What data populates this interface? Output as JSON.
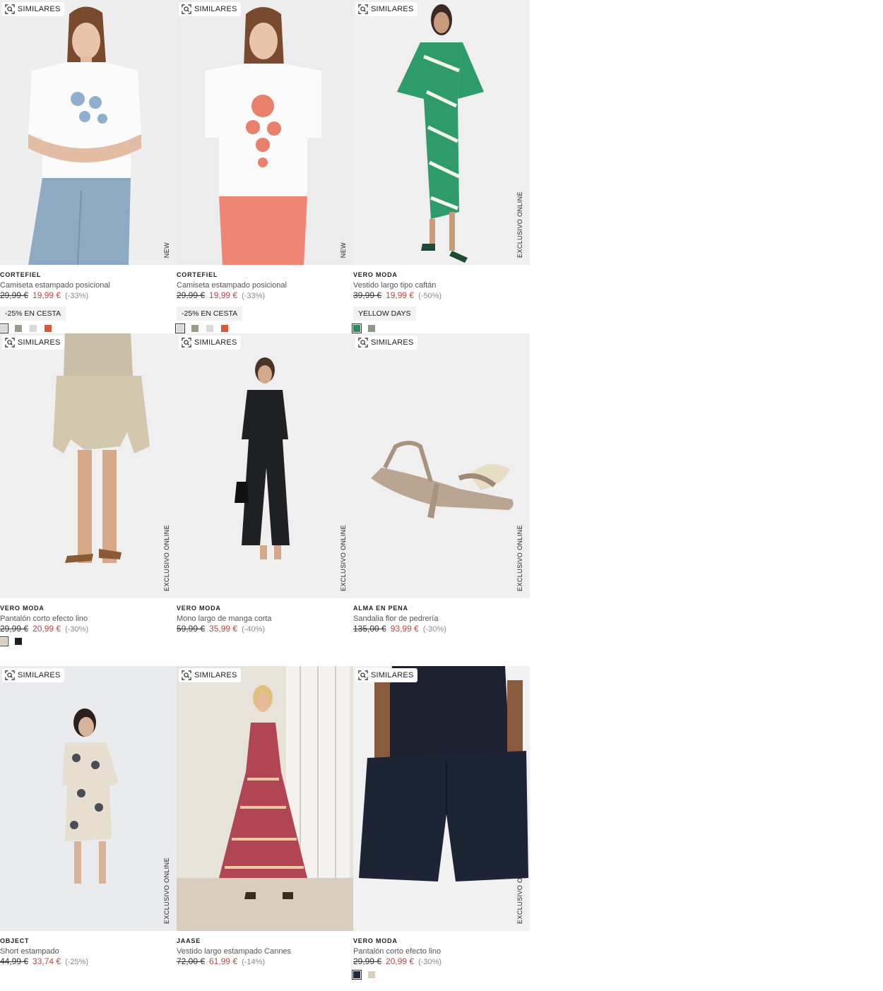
{
  "similar_label": "SIMILARES",
  "products": [
    {
      "brand": "CORTEFIEL",
      "name": "Camiseta estampado posicional",
      "old_price": "29,99 €",
      "new_price": "19,99 €",
      "discount": "(-33%)",
      "tag": "NEW",
      "promo": "-25% EN CESTA",
      "swatches": [
        "#d9d9d9",
        "#9c9a8c",
        "#d8d8de",
        "#d9593c"
      ]
    },
    {
      "brand": "CORTEFIEL",
      "name": "Camiseta estampado posicional",
      "old_price": "29,99 €",
      "new_price": "19,99 €",
      "discount": "(-33%)",
      "tag": "NEW",
      "promo": "-25% EN CESTA",
      "swatches": [
        "#d9d9d9",
        "#9c9a8c",
        "#d8d8de",
        "#d9593c"
      ]
    },
    {
      "brand": "VERO MODA",
      "name": "Vestido largo tipo caftán",
      "old_price": "39,99 €",
      "new_price": "19,99 €",
      "discount": "(-50%)",
      "tag": "EXCLUSIVO ONLINE",
      "promo": "YELLOW DAYS",
      "swatches": [
        "#2e8a5b",
        "#8b9a86"
      ]
    },
    {
      "brand": "VERO MODA",
      "name": "Pantalón corto efecto lino",
      "old_price": "29,99 €",
      "new_price": "20,99 €",
      "discount": "(-30%)",
      "tag": "EXCLUSIVO ONLINE",
      "promo": "",
      "swatches": [
        "#d8d0bc",
        "#1f1f1f"
      ]
    },
    {
      "brand": "VERO MODA",
      "name": "Mono largo de manga corta",
      "old_price": "59,99 €",
      "new_price": "35,99 €",
      "discount": "(-40%)",
      "tag": "EXCLUSIVO ONLINE",
      "promo": "",
      "swatches": []
    },
    {
      "brand": "ALMA EN PENA",
      "name": "Sandalia flor de pedrería",
      "old_price": "135,00 €",
      "new_price": "93,99 €",
      "discount": "(-30%)",
      "tag": "EXCLUSIVO ONLINE",
      "promo": "",
      "swatches": []
    },
    {
      "brand": "OBJECT",
      "name": "Short estampado",
      "old_price": "44,99 €",
      "new_price": "33,74 €",
      "discount": "(-25%)",
      "tag": "EXCLUSIVO ONLINE",
      "promo": "",
      "swatches": []
    },
    {
      "brand": "JAASE",
      "name": "Vestido largo estampado Cannes",
      "old_price": "72,00 €",
      "new_price": "61,99 €",
      "discount": "(-14%)",
      "tag": "",
      "promo": "",
      "swatches": []
    },
    {
      "brand": "VERO MODA",
      "name": "Pantalón corto efecto lino",
      "old_price": "29,99 €",
      "new_price": "20,99 €",
      "discount": "(-30%)",
      "tag": "EXCLUSIVO ONLINE",
      "promo": "",
      "swatches": [
        "#1f2a3d",
        "#d8d0bc"
      ]
    }
  ]
}
